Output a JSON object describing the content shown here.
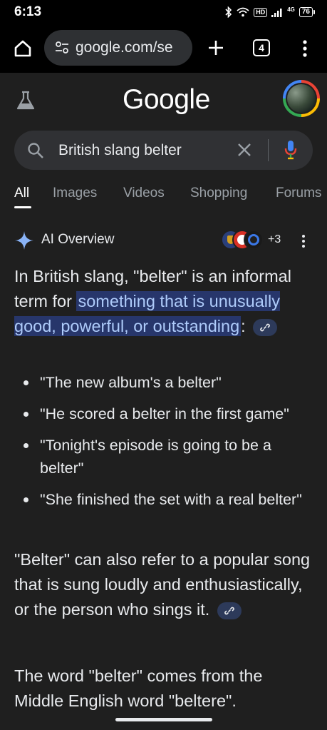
{
  "status": {
    "time": "6:13",
    "hd_label": "HD",
    "net_label": "4G",
    "battery": "76"
  },
  "browser": {
    "url": "google.com/se",
    "tab_count": "4"
  },
  "header": {
    "logo": "Google"
  },
  "search": {
    "query": "British slang belter"
  },
  "tabs": [
    {
      "label": "All",
      "active": true
    },
    {
      "label": "Images"
    },
    {
      "label": "Videos"
    },
    {
      "label": "Shopping"
    },
    {
      "label": "Forums"
    }
  ],
  "ai_overview": {
    "title": "AI Overview",
    "sources_more": "+3",
    "intro_before": "In British slang, \"belter\" is an informal term for ",
    "intro_highlight": "something that is unusually good, powerful, or outstanding",
    "intro_after": ":",
    "examples": [
      "\"The new album's a belter\"",
      "\"He scored a belter in the first game\"",
      "\"Tonight's episode is going to be a belter\"",
      "\"She finished the set with a real belter\""
    ],
    "para2": "\"Belter\" can also refer to a popular song that is sung loudly and enthusiastically, or the person who sings it.",
    "para3": "The word \"belter\" comes from the Middle English word \"beltere\"."
  },
  "colors": {
    "background": "#1f1f1f",
    "highlight_bg": "#27366b",
    "highlight_text": "#aecbfa",
    "accent_blue": "#4285f4"
  },
  "icons": [
    "home-icon",
    "tune-icon",
    "plus-icon",
    "tabs-icon",
    "more-vert-icon",
    "flask-icon",
    "search-icon",
    "close-icon",
    "mic-icon",
    "sparkle-icon",
    "link-icon"
  ]
}
